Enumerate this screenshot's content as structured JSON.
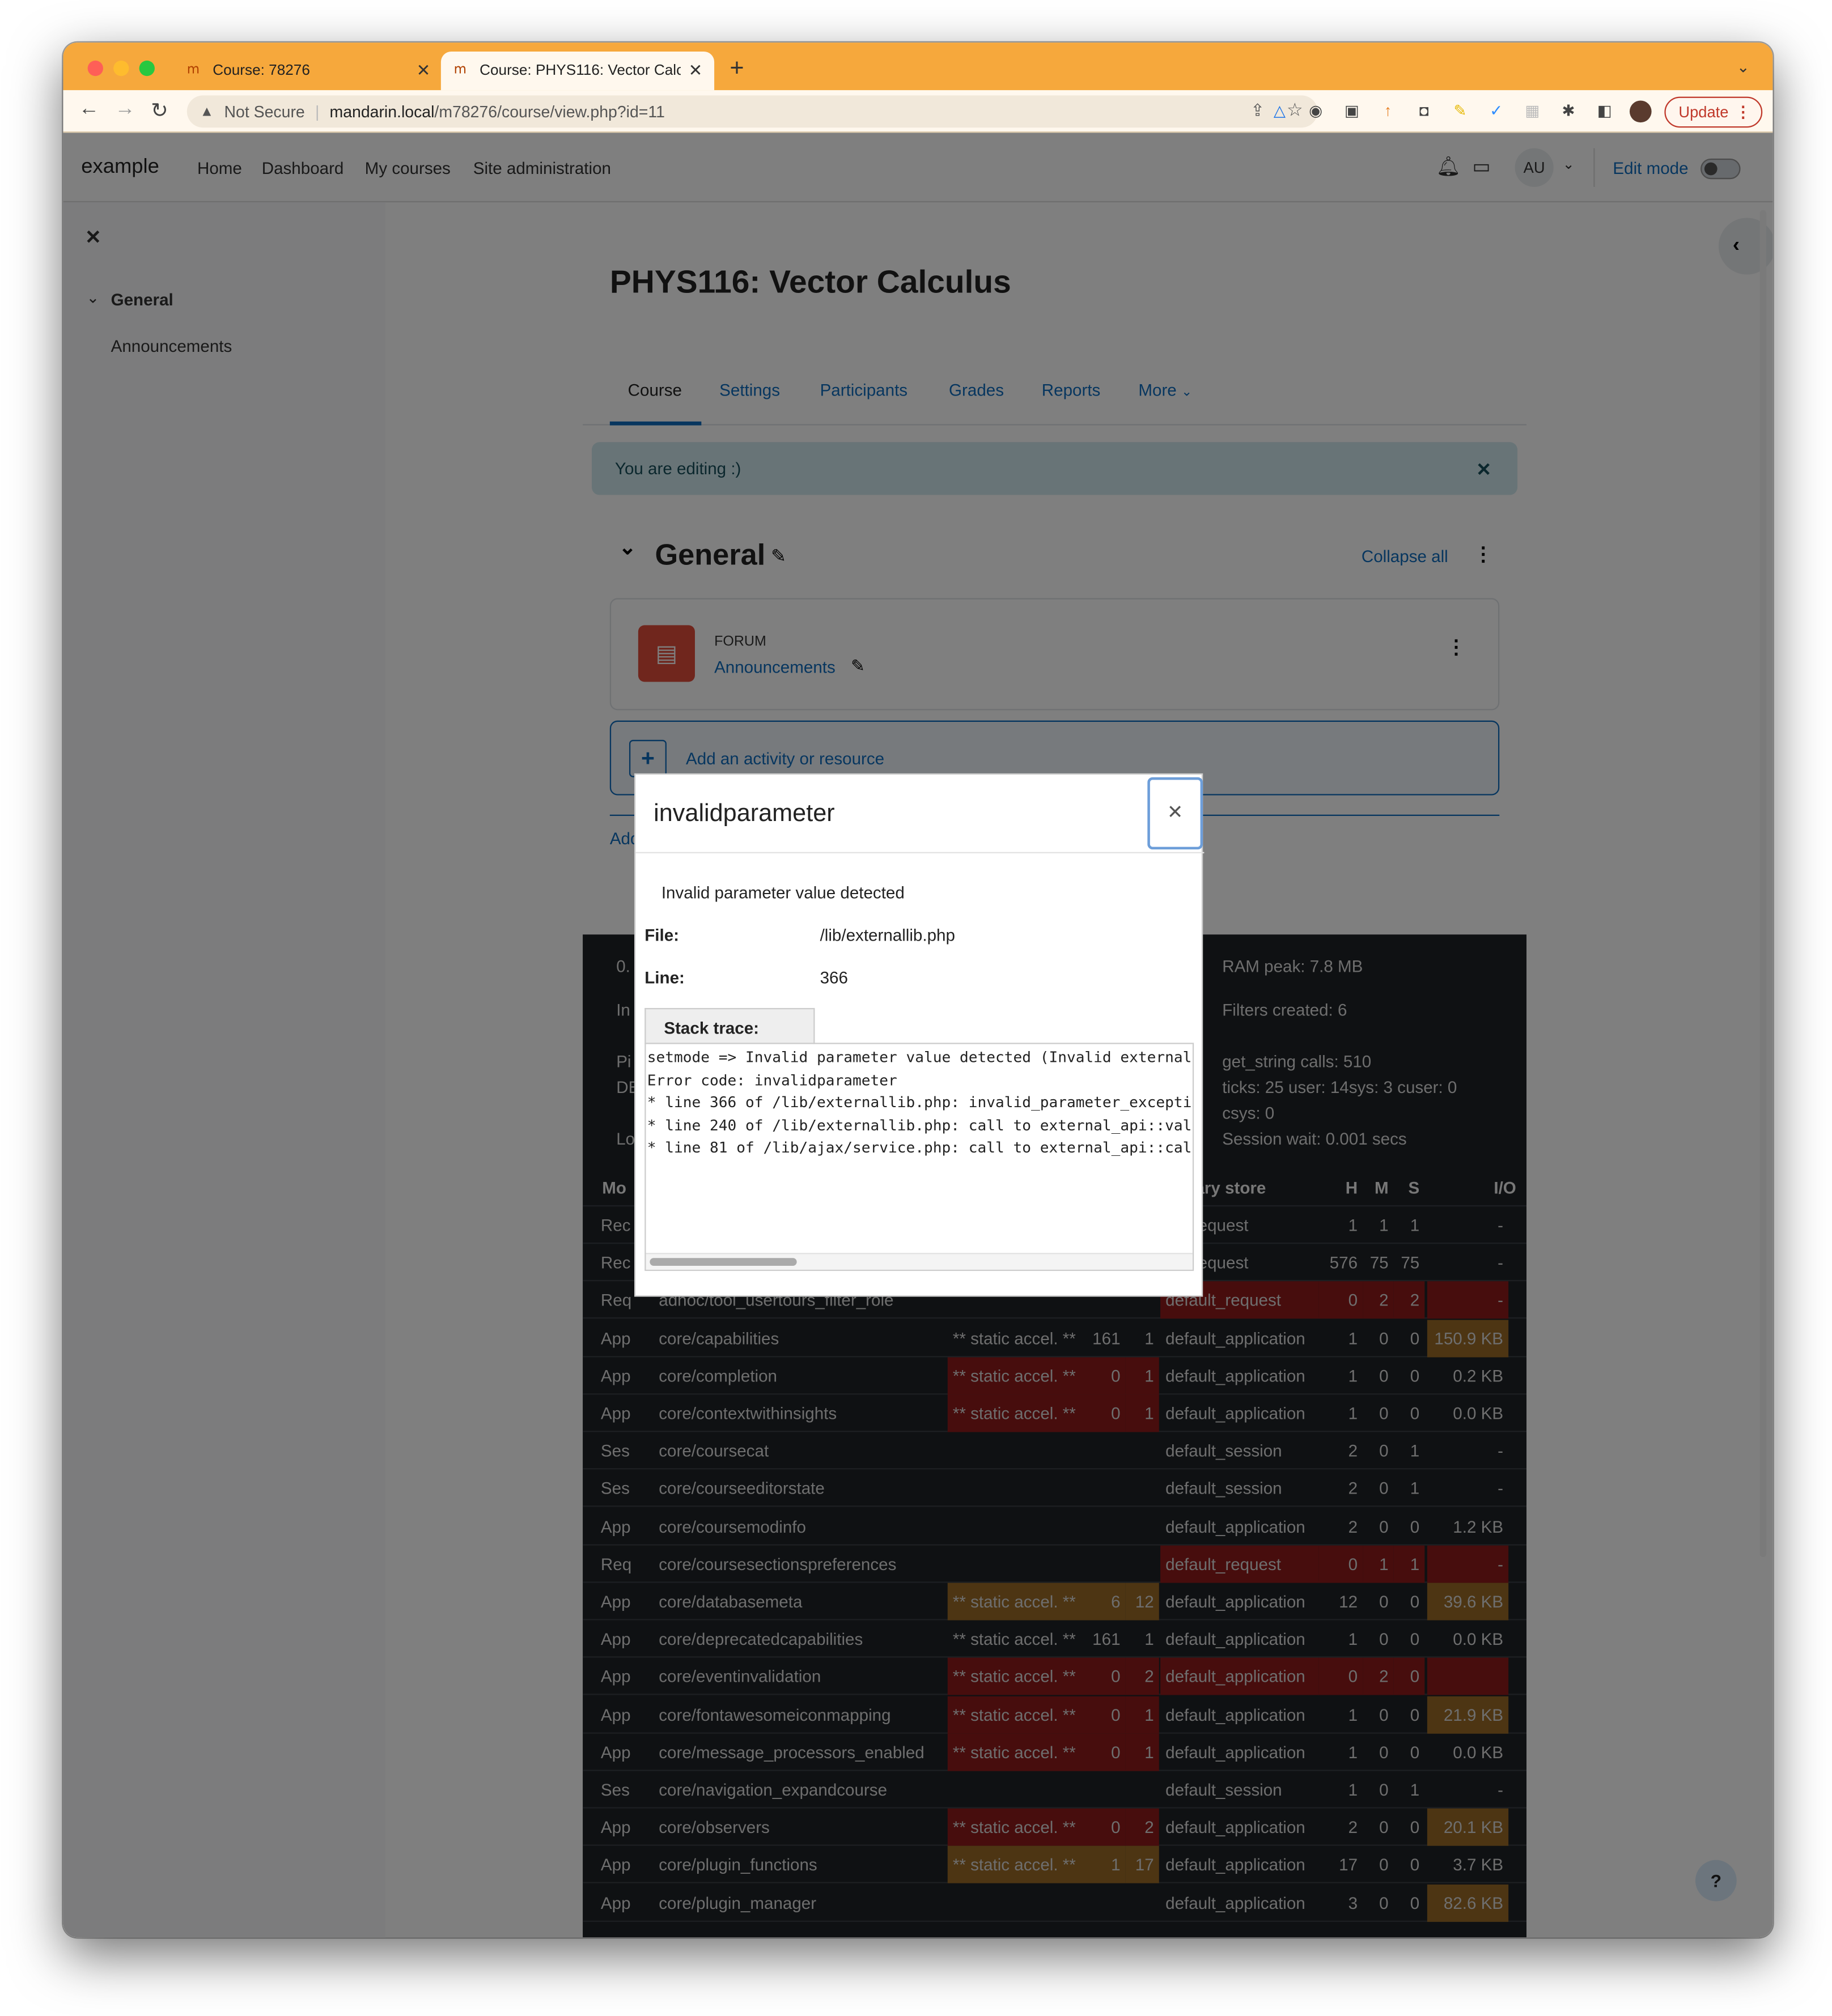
{
  "browser": {
    "tabs": [
      {
        "title": "Course: 78276"
      },
      {
        "title": "Course: PHYS116: Vector Calcu"
      }
    ],
    "security": "Not Secure",
    "url_host": "mandarin.local",
    "url_path": "/m78276/course/view.php?id=11",
    "update_label": "Update",
    "accent": "#f6a83c"
  },
  "navbar": {
    "brand": "example",
    "links": [
      "Home",
      "Dashboard",
      "My courses",
      "Site administration"
    ],
    "avatar": "AU",
    "edit_mode": "Edit mode"
  },
  "drawer": {
    "section": "General",
    "item": "Announcements"
  },
  "course": {
    "title": "PHYS116: Vector Calculus",
    "tabs": [
      "Course",
      "Settings",
      "Participants",
      "Grades",
      "Reports",
      "More"
    ],
    "editing_notice": "You are editing :)",
    "section_title": "General",
    "collapse_all": "Collapse all",
    "activity_type": "FORUM",
    "activity_name": "Announcements",
    "add_activity": "Add an activity or resource",
    "add_section_partial": "Add"
  },
  "perf": {
    "stats_right": [
      "RAM peak: 7.8 MB",
      "Filters created: 6",
      "get_string calls: 510",
      "ticks: 25 user: 14sys: 3 cuser: 0",
      "csys: 0",
      "Session wait: 0.001 secs"
    ],
    "stats_left_partial": [
      "0.",
      "In",
      "Pi",
      "DE",
      "Lo"
    ],
    "headers": {
      "mode": "Mo",
      "store": "ary store",
      "h": "H",
      "m": "M",
      "s": "S",
      "io": "I/O"
    },
    "rows": [
      {
        "mode": "Rec",
        "def": "",
        "accel": "",
        "n1": "",
        "n2": "",
        "store": "ult_request",
        "h": "1",
        "m": "1",
        "s": "1",
        "io": "-"
      },
      {
        "mode": "Rec",
        "def": "",
        "accel": "",
        "n1": "",
        "n2": "",
        "store": "ult_request",
        "h": "576",
        "m": "75",
        "s": "75",
        "io": "-"
      },
      {
        "mode": "Req",
        "def": "adhoc/tool_usertours_filter_role",
        "accel": "",
        "n1": "",
        "n2": "",
        "store": "default_request",
        "h": "0",
        "m": "2",
        "s": "2",
        "io": "-"
      },
      {
        "mode": "App",
        "def": "core/capabilities",
        "accel": "** static accel. **",
        "n1": "161",
        "n2": "1",
        "store": "default_application",
        "h": "1",
        "m": "0",
        "s": "0",
        "io": "150.9 KB"
      },
      {
        "mode": "App",
        "def": "core/completion",
        "accel": "** static accel. **",
        "n1": "0",
        "n2": "1",
        "store": "default_application",
        "h": "1",
        "m": "0",
        "s": "0",
        "io": "0.2 KB"
      },
      {
        "mode": "App",
        "def": "core/contextwithinsights",
        "accel": "** static accel. **",
        "n1": "0",
        "n2": "1",
        "store": "default_application",
        "h": "1",
        "m": "0",
        "s": "0",
        "io": "0.0 KB"
      },
      {
        "mode": "Ses",
        "def": "core/coursecat",
        "accel": "",
        "n1": "",
        "n2": "",
        "store": "default_session",
        "h": "2",
        "m": "0",
        "s": "1",
        "io": "-"
      },
      {
        "mode": "Ses",
        "def": "core/courseeditorstate",
        "accel": "",
        "n1": "",
        "n2": "",
        "store": "default_session",
        "h": "2",
        "m": "0",
        "s": "1",
        "io": "-"
      },
      {
        "mode": "App",
        "def": "core/coursemodinfo",
        "accel": "",
        "n1": "",
        "n2": "",
        "store": "default_application",
        "h": "2",
        "m": "0",
        "s": "0",
        "io": "1.2 KB"
      },
      {
        "mode": "Req",
        "def": "core/coursesectionspreferences",
        "accel": "",
        "n1": "",
        "n2": "",
        "store": "default_request",
        "h": "0",
        "m": "1",
        "s": "1",
        "io": "-"
      },
      {
        "mode": "App",
        "def": "core/databasemeta",
        "accel": "** static accel. **",
        "n1": "6",
        "n2": "12",
        "store": "default_application",
        "h": "12",
        "m": "0",
        "s": "0",
        "io": "39.6 KB"
      },
      {
        "mode": "App",
        "def": "core/deprecatedcapabilities",
        "accel": "** static accel. **",
        "n1": "161",
        "n2": "1",
        "store": "default_application",
        "h": "1",
        "m": "0",
        "s": "0",
        "io": "0.0 KB"
      },
      {
        "mode": "App",
        "def": "core/eventinvalidation",
        "accel": "** static accel. **",
        "n1": "0",
        "n2": "2",
        "store": "default_application",
        "h": "0",
        "m": "2",
        "s": "0",
        "io": ""
      },
      {
        "mode": "App",
        "def": "core/fontawesomeiconmapping",
        "accel": "** static accel. **",
        "n1": "0",
        "n2": "1",
        "store": "default_application",
        "h": "1",
        "m": "0",
        "s": "0",
        "io": "21.9 KB"
      },
      {
        "mode": "App",
        "def": "core/message_processors_enabled",
        "accel": "** static accel. **",
        "n1": "0",
        "n2": "1",
        "store": "default_application",
        "h": "1",
        "m": "0",
        "s": "0",
        "io": "0.0 KB"
      },
      {
        "mode": "Ses",
        "def": "core/navigation_expandcourse",
        "accel": "",
        "n1": "",
        "n2": "",
        "store": "default_session",
        "h": "1",
        "m": "0",
        "s": "1",
        "io": "-"
      },
      {
        "mode": "App",
        "def": "core/observers",
        "accel": "** static accel. **",
        "n1": "0",
        "n2": "2",
        "store": "default_application",
        "h": "2",
        "m": "0",
        "s": "0",
        "io": "20.1 KB"
      },
      {
        "mode": "App",
        "def": "core/plugin_functions",
        "accel": "** static accel. **",
        "n1": "1",
        "n2": "17",
        "store": "default_application",
        "h": "17",
        "m": "0",
        "s": "0",
        "io": "3.7 KB"
      },
      {
        "mode": "App",
        "def": "core/plugin_manager",
        "accel": "",
        "n1": "",
        "n2": "",
        "store": "default_application",
        "h": "3",
        "m": "0",
        "s": "0",
        "io": "82.6 KB"
      }
    ]
  },
  "modal": {
    "title": "invalidparameter",
    "message": "Invalid parameter value detected",
    "file_label": "File:",
    "file_value": "/lib/externallib.php",
    "line_label": "Line:",
    "line_value": "366",
    "stack_label": "Stack trace:",
    "trace": [
      "setmode => Invalid parameter value detected (Invalid external",
      "Error code: invalidparameter",
      "* line 366 of /lib/externallib.php: invalid_parameter_excepti",
      "* line 240 of /lib/externallib.php: call to external_api::val",
      "* line 81 of /lib/ajax/service.php: call to external_api::cal"
    ]
  },
  "help_label": "?"
}
